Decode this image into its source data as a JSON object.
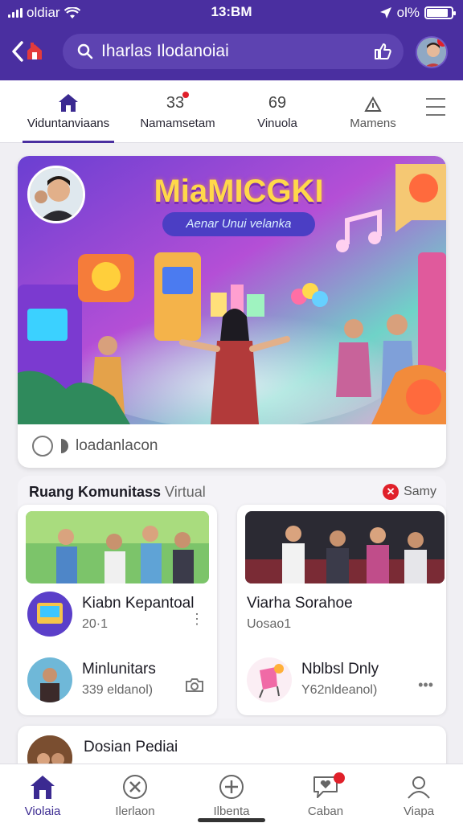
{
  "status": {
    "carrier": "oldiar",
    "time": "13:BM",
    "battery": "ol%"
  },
  "header": {
    "search_text": "Iharlas Ilodanoiai"
  },
  "tabs": [
    {
      "icon": "home-icon",
      "label": "Viduntanviaans",
      "active": true
    },
    {
      "icon": "number-badge",
      "number": "33",
      "label": "Namamsetam",
      "active": false
    },
    {
      "icon": "number-badge",
      "number": "69",
      "label": "Vinuola",
      "active": false
    },
    {
      "icon": "triangle-icon",
      "label": "Mamens",
      "active": false
    }
  ],
  "hero": {
    "title": "MiaMICGKI",
    "subtitle": "Aenar Unui velanka",
    "footer_text": "loadanlacon"
  },
  "community": {
    "title": "Ruang Komunitass",
    "title_suffix": "Virtual",
    "badge_label": "Samy",
    "cards": [
      {
        "row1": {
          "title": "Kiabn Kepantoal",
          "meta": "20·1"
        },
        "row2": {
          "title": "Minlunitars",
          "meta": "339 eldanol)"
        }
      },
      {
        "row1": {
          "title": "Viarha Sorahoe",
          "meta": "Uosao1"
        },
        "row2": {
          "title": "Nblbsl Dnly",
          "meta": "Y62nldeanol)"
        }
      }
    ]
  },
  "next_card": {
    "title": "Dosian Pediai"
  },
  "bottom_nav": [
    {
      "icon": "home-icon",
      "label": "Violaia",
      "active": true
    },
    {
      "icon": "tools-icon",
      "label": "Ilerlaon",
      "active": false
    },
    {
      "icon": "plus-icon",
      "label": "Ilbenta",
      "active": false
    },
    {
      "icon": "heart-chat-icon",
      "label": "Caban",
      "active": false
    },
    {
      "icon": "user-icon",
      "label": "Viapa",
      "active": false
    }
  ],
  "colors": {
    "brand": "#4a2fa0",
    "notification": "#e0202a"
  }
}
